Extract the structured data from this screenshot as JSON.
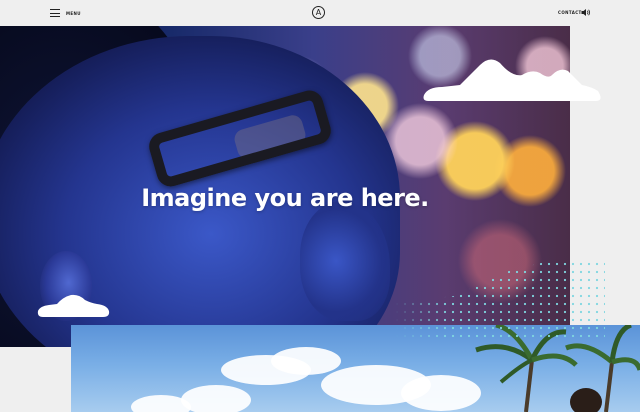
{
  "header": {
    "menu_label": "MENU",
    "logo_letter": "A",
    "contact_label": "CONTACT"
  },
  "hero": {
    "headline": "Imagine you are here."
  },
  "icons": {
    "menu": "hamburger-icon",
    "logo": "brand-logo",
    "sound": "speaker-icon"
  },
  "colors": {
    "background": "#efefef",
    "text_dark": "#222222",
    "headline": "#ffffff",
    "cloud": "#ffffff",
    "dots": "#7fd6e0"
  }
}
